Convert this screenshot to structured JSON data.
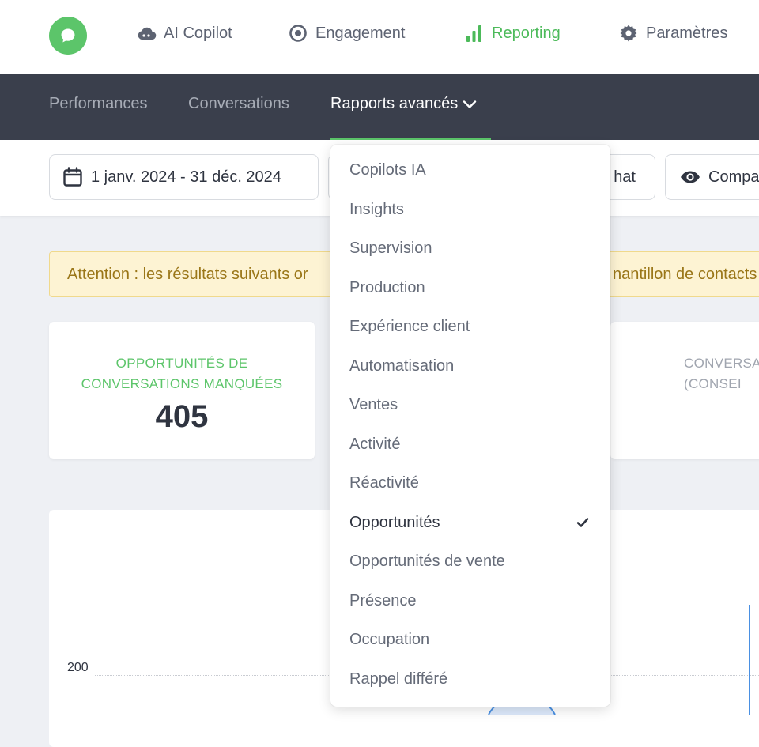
{
  "topnav": {
    "items": [
      {
        "label": "AI Copilot",
        "icon": "cloud-icon"
      },
      {
        "label": "Engagement",
        "icon": "target-icon"
      },
      {
        "label": "Reporting",
        "icon": "bar-chart-icon",
        "active": true
      },
      {
        "label": "Paramètres",
        "icon": "gear-icon"
      }
    ]
  },
  "subnav": {
    "tabs": [
      {
        "label": "Performances"
      },
      {
        "label": "Conversations"
      },
      {
        "label": "Rapports avancés",
        "active": true
      }
    ]
  },
  "filters": {
    "date_range": "1 janv. 2024 - 31 déc. 2024",
    "channel_partial": "hat",
    "compare_partial": "Compa"
  },
  "banner": {
    "text_start": "Attention : les résultats suivants or",
    "text_end": "nantillon de contacts"
  },
  "kpis": [
    {
      "label": "OPPORTUNITÉS DE CONVERSATIONS MANQUÉES",
      "value": "405"
    },
    {
      "label": "CONVERSA (CONSEI",
      "value": ""
    }
  ],
  "chart": {
    "ytick_label": "200"
  },
  "dropdown": {
    "items": [
      {
        "label": "Copilots IA"
      },
      {
        "label": "Insights"
      },
      {
        "label": "Supervision"
      },
      {
        "label": "Production"
      },
      {
        "label": "Expérience client"
      },
      {
        "label": "Automatisation"
      },
      {
        "label": "Ventes"
      },
      {
        "label": "Activité"
      },
      {
        "label": "Réactivité"
      },
      {
        "label": "Opportunités",
        "selected": true
      },
      {
        "label": "Opportunités de vente"
      },
      {
        "label": "Présence"
      },
      {
        "label": "Occupation"
      },
      {
        "label": "Rappel différé"
      }
    ]
  },
  "colors": {
    "accent_green": "#5cc56a",
    "subnav_bg": "#3a3f4c",
    "banner_bg": "#fdf3d3",
    "banner_text": "#9a7618"
  }
}
